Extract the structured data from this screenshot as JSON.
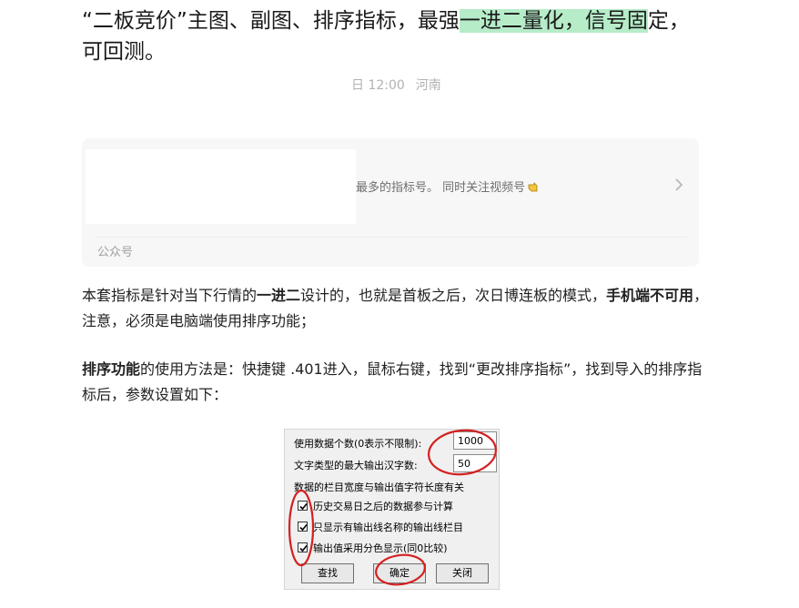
{
  "article": {
    "title_part1": "“二板竞价”主图、副图、排序指标，最强",
    "title_highlight": "一进二量化，信号固",
    "title_part2": "定，可回测。",
    "meta_time": "日 12:00",
    "meta_location": "河南"
  },
  "account_card": {
    "description": "最多的指标号。 同时关注视频号",
    "footer_label": "公众号"
  },
  "paragraphs": {
    "p1_a": "本套指标是针对当下行情的",
    "p1_b": "一进二",
    "p1_c": "设计的，也就是首板之后，次日博连板的模式，",
    "p1_d": "手机端不可用",
    "p1_e": "，注意，必须是电脑端使用排序功能；",
    "p2_a": "排序功能",
    "p2_b": "的使用方法是：快捷键 .401进入，鼠标右键，找到“更改排序指标”，找到导入的排序指标后，参数设置如下："
  },
  "dialog": {
    "row1_label": "使用数据个数(0表示不限制):",
    "row1_value": "1000",
    "row2_label": "文字类型的最大输出汉字数:",
    "row2_value": "50",
    "row3_label": "数据的栏目宽度与输出值字符长度有关",
    "checkbox1_label": "历史交易日之后的数据参与计算",
    "checkbox2_label": "只显示有输出线名称的输出线栏目",
    "checkbox3_label": "输出值采用分色显示(同0比较)",
    "btn_find": "查找",
    "btn_ok": "确定",
    "btn_close": "关闭"
  },
  "colors": {
    "highlight": "#b6ecc8",
    "annotation": "#d42020",
    "card_bg": "#f7f7f7"
  }
}
